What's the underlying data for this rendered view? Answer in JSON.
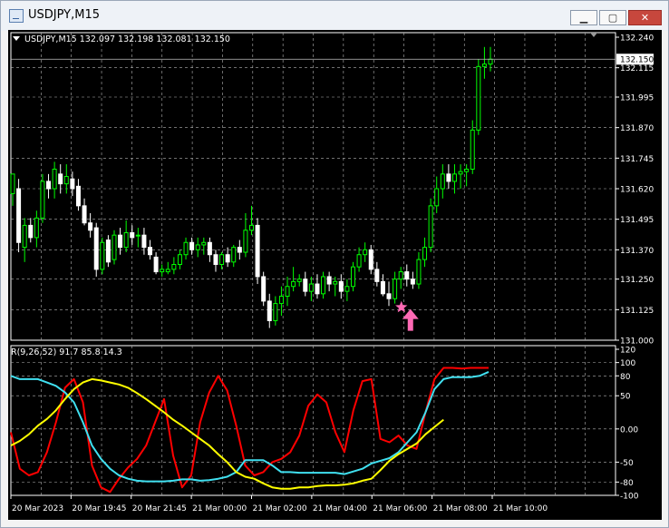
{
  "window": {
    "title": "USDJPY,M15",
    "minimize_glyph": "▁",
    "maximize_glyph": "▢",
    "close_glyph": "✕"
  },
  "icons": {
    "app": "chart-window-icon",
    "header_arrow": "triangle-down-icon",
    "signal_star": "star-icon",
    "signal_arrow": "up-arrow-icon"
  },
  "chart_data": [
    {
      "type": "candlestick",
      "symbol_header": "USDJPY,M15  132.097 132.198 132.081 132.150",
      "current_price_label": "132.150",
      "current_price": 132.15,
      "ylim": [
        131.0,
        132.24
      ],
      "y_ticks": [
        "132.240",
        "132.115",
        "131.995",
        "131.870",
        "131.745",
        "131.620",
        "131.495",
        "131.370",
        "131.250",
        "131.125",
        "131.000"
      ],
      "x_ticks": [
        "20 Mar 2023",
        "20 Mar 19:45",
        "20 Mar 21:45",
        "21 Mar 00:00",
        "21 Mar 02:00",
        "21 Mar 04:00",
        "21 Mar 06:00",
        "21 Mar 08:00",
        "21 Mar 10:00"
      ],
      "grid": true,
      "colors": {
        "background": "#000000",
        "bull": "#00ff00",
        "bear": "#ffffff",
        "grid": "#b4b4b4",
        "text": "#ffffff",
        "signal": "#ff69b4"
      },
      "signal": {
        "candle_index": 66,
        "price": 131.12
      },
      "candles": [
        [
          131.6,
          131.68,
          131.55,
          131.68
        ],
        [
          131.62,
          131.66,
          131.36,
          131.4
        ],
        [
          131.38,
          131.5,
          131.32,
          131.47
        ],
        [
          131.47,
          131.5,
          131.4,
          131.42
        ],
        [
          131.42,
          131.53,
          131.38,
          131.5
        ],
        [
          131.5,
          131.68,
          131.48,
          131.65
        ],
        [
          131.65,
          131.68,
          131.58,
          131.62
        ],
        [
          131.62,
          131.73,
          131.58,
          131.7
        ],
        [
          131.68,
          131.72,
          131.6,
          131.64
        ],
        [
          131.64,
          131.72,
          131.6,
          131.67
        ],
        [
          131.66,
          131.69,
          131.59,
          131.62
        ],
        [
          131.63,
          131.66,
          131.53,
          131.55
        ],
        [
          131.55,
          131.58,
          131.47,
          131.48
        ],
        [
          131.48,
          131.52,
          131.42,
          131.45
        ],
        [
          131.46,
          131.48,
          131.26,
          131.29
        ],
        [
          131.29,
          131.42,
          131.27,
          131.4
        ],
        [
          131.41,
          131.43,
          131.3,
          131.32
        ],
        [
          131.33,
          131.45,
          131.31,
          131.43
        ],
        [
          131.43,
          131.46,
          131.35,
          131.38
        ],
        [
          131.38,
          131.49,
          131.36,
          131.44
        ],
        [
          131.44,
          131.47,
          131.39,
          131.42
        ],
        [
          131.43,
          131.46,
          131.38,
          131.43
        ],
        [
          131.43,
          131.46,
          131.35,
          131.38
        ],
        [
          131.38,
          131.41,
          131.33,
          131.35
        ],
        [
          131.34,
          131.36,
          131.27,
          131.28
        ],
        [
          131.28,
          131.31,
          131.26,
          131.29
        ],
        [
          131.28,
          131.32,
          131.27,
          131.29
        ],
        [
          131.29,
          131.34,
          131.27,
          131.31
        ],
        [
          131.31,
          131.37,
          131.29,
          131.35
        ],
        [
          131.35,
          131.42,
          131.33,
          131.4
        ],
        [
          131.4,
          131.42,
          131.35,
          131.37
        ],
        [
          131.37,
          131.42,
          131.34,
          131.39
        ],
        [
          131.39,
          131.42,
          131.35,
          131.4
        ],
        [
          131.4,
          131.42,
          131.32,
          131.35
        ],
        [
          131.35,
          131.37,
          131.28,
          131.31
        ],
        [
          131.31,
          131.36,
          131.29,
          131.35
        ],
        [
          131.35,
          131.38,
          131.3,
          131.32
        ],
        [
          131.32,
          131.39,
          131.3,
          131.38
        ],
        [
          131.38,
          131.41,
          131.33,
          131.36
        ],
        [
          131.36,
          131.52,
          131.34,
          131.45
        ],
        [
          131.45,
          131.55,
          131.43,
          131.47
        ],
        [
          131.47,
          131.5,
          131.23,
          131.26
        ],
        [
          131.26,
          131.28,
          131.14,
          131.16
        ],
        [
          131.16,
          131.19,
          131.05,
          131.08
        ],
        [
          131.08,
          131.18,
          131.06,
          131.15
        ],
        [
          131.15,
          131.22,
          131.1,
          131.18
        ],
        [
          131.18,
          131.26,
          131.14,
          131.22
        ],
        [
          131.22,
          131.3,
          131.2,
          131.24
        ],
        [
          131.24,
          131.27,
          131.22,
          131.25
        ],
        [
          131.25,
          131.28,
          131.18,
          131.2
        ],
        [
          131.2,
          131.26,
          131.16,
          131.23
        ],
        [
          131.23,
          131.27,
          131.17,
          131.19
        ],
        [
          131.19,
          131.28,
          131.17,
          131.26
        ],
        [
          131.26,
          131.28,
          131.2,
          131.23
        ],
        [
          131.23,
          131.26,
          131.18,
          131.24
        ],
        [
          131.24,
          131.27,
          131.17,
          131.2
        ],
        [
          131.2,
          131.25,
          131.16,
          131.22
        ],
        [
          131.22,
          131.32,
          131.2,
          131.3
        ],
        [
          131.3,
          131.38,
          131.28,
          131.35
        ],
        [
          131.35,
          131.4,
          131.32,
          131.37
        ],
        [
          131.37,
          131.39,
          131.27,
          131.29
        ],
        [
          131.29,
          131.32,
          131.22,
          131.24
        ],
        [
          131.24,
          131.27,
          131.18,
          131.19
        ],
        [
          131.19,
          131.24,
          131.14,
          131.17
        ],
        [
          131.17,
          131.28,
          131.15,
          131.25
        ],
        [
          131.25,
          131.3,
          131.21,
          131.28
        ],
        [
          131.28,
          131.31,
          131.22,
          131.25
        ],
        [
          131.25,
          131.28,
          131.21,
          131.23
        ],
        [
          131.23,
          131.36,
          131.21,
          131.33
        ],
        [
          131.33,
          131.42,
          131.3,
          131.38
        ],
        [
          131.38,
          131.58,
          131.36,
          131.55
        ],
        [
          131.55,
          131.67,
          131.52,
          131.62
        ],
        [
          131.62,
          131.72,
          131.58,
          131.68
        ],
        [
          131.68,
          131.72,
          131.62,
          131.65
        ],
        [
          131.65,
          131.72,
          131.6,
          131.68
        ],
        [
          131.68,
          131.72,
          131.62,
          131.69
        ],
        [
          131.69,
          131.72,
          131.63,
          131.7
        ],
        [
          131.7,
          131.9,
          131.68,
          131.86
        ],
        [
          131.86,
          132.15,
          131.84,
          132.12
        ],
        [
          132.12,
          132.2,
          132.07,
          132.13
        ],
        [
          132.13,
          132.2,
          132.1,
          132.15
        ]
      ]
    },
    {
      "type": "line",
      "legend": "R(9,26,52) 91.7 85.8 14.3",
      "ylim": [
        -100,
        120
      ],
      "y_ticks": [
        "120",
        "100",
        "80",
        "50",
        "0.00",
        "-50",
        "-80",
        "-100"
      ],
      "series": [
        {
          "color": "#ff0000",
          "values": [
            -5,
            -60,
            -70,
            -65,
            -35,
            10,
            62,
            75,
            40,
            -55,
            -88,
            -95,
            -75,
            -58,
            -45,
            -25,
            10,
            45,
            -40,
            -88,
            -70,
            10,
            55,
            80,
            58,
            5,
            -55,
            -70,
            -65,
            -50,
            -45,
            -35,
            -10,
            35,
            52,
            40,
            -5,
            -35,
            28,
            72,
            75,
            -15,
            -20,
            -10,
            -25,
            -30,
            25,
            75,
            92,
            92,
            91,
            92,
            92,
            92
          ]
        },
        {
          "color": "#40e0f0",
          "values": [
            80,
            75,
            75,
            75,
            70,
            65,
            55,
            40,
            10,
            -25,
            -45,
            -60,
            -70,
            -75,
            -78,
            -79,
            -79,
            -79,
            -78,
            -76,
            -76,
            -78,
            -77,
            -75,
            -72,
            -65,
            -47,
            -47,
            -47,
            -55,
            -65,
            -65,
            -66,
            -66,
            -66,
            -66,
            -66,
            -68,
            -64,
            -60,
            -52,
            -48,
            -44,
            -35,
            -20,
            -5,
            25,
            60,
            75,
            78,
            78,
            78,
            80,
            86
          ]
        },
        {
          "color": "#ffff00",
          "values": [
            -25,
            -18,
            -8,
            5,
            15,
            28,
            45,
            60,
            70,
            75,
            73,
            70,
            67,
            62,
            54,
            45,
            35,
            25,
            14,
            5,
            -5,
            -15,
            -25,
            -38,
            -50,
            -65,
            -72,
            -75,
            -82,
            -88,
            -90,
            -90,
            -88,
            -88,
            -86,
            -85,
            -85,
            -84,
            -82,
            -78,
            -75,
            -62,
            -48,
            -38,
            -30,
            -22,
            -8,
            3,
            14
          ]
        }
      ]
    }
  ]
}
